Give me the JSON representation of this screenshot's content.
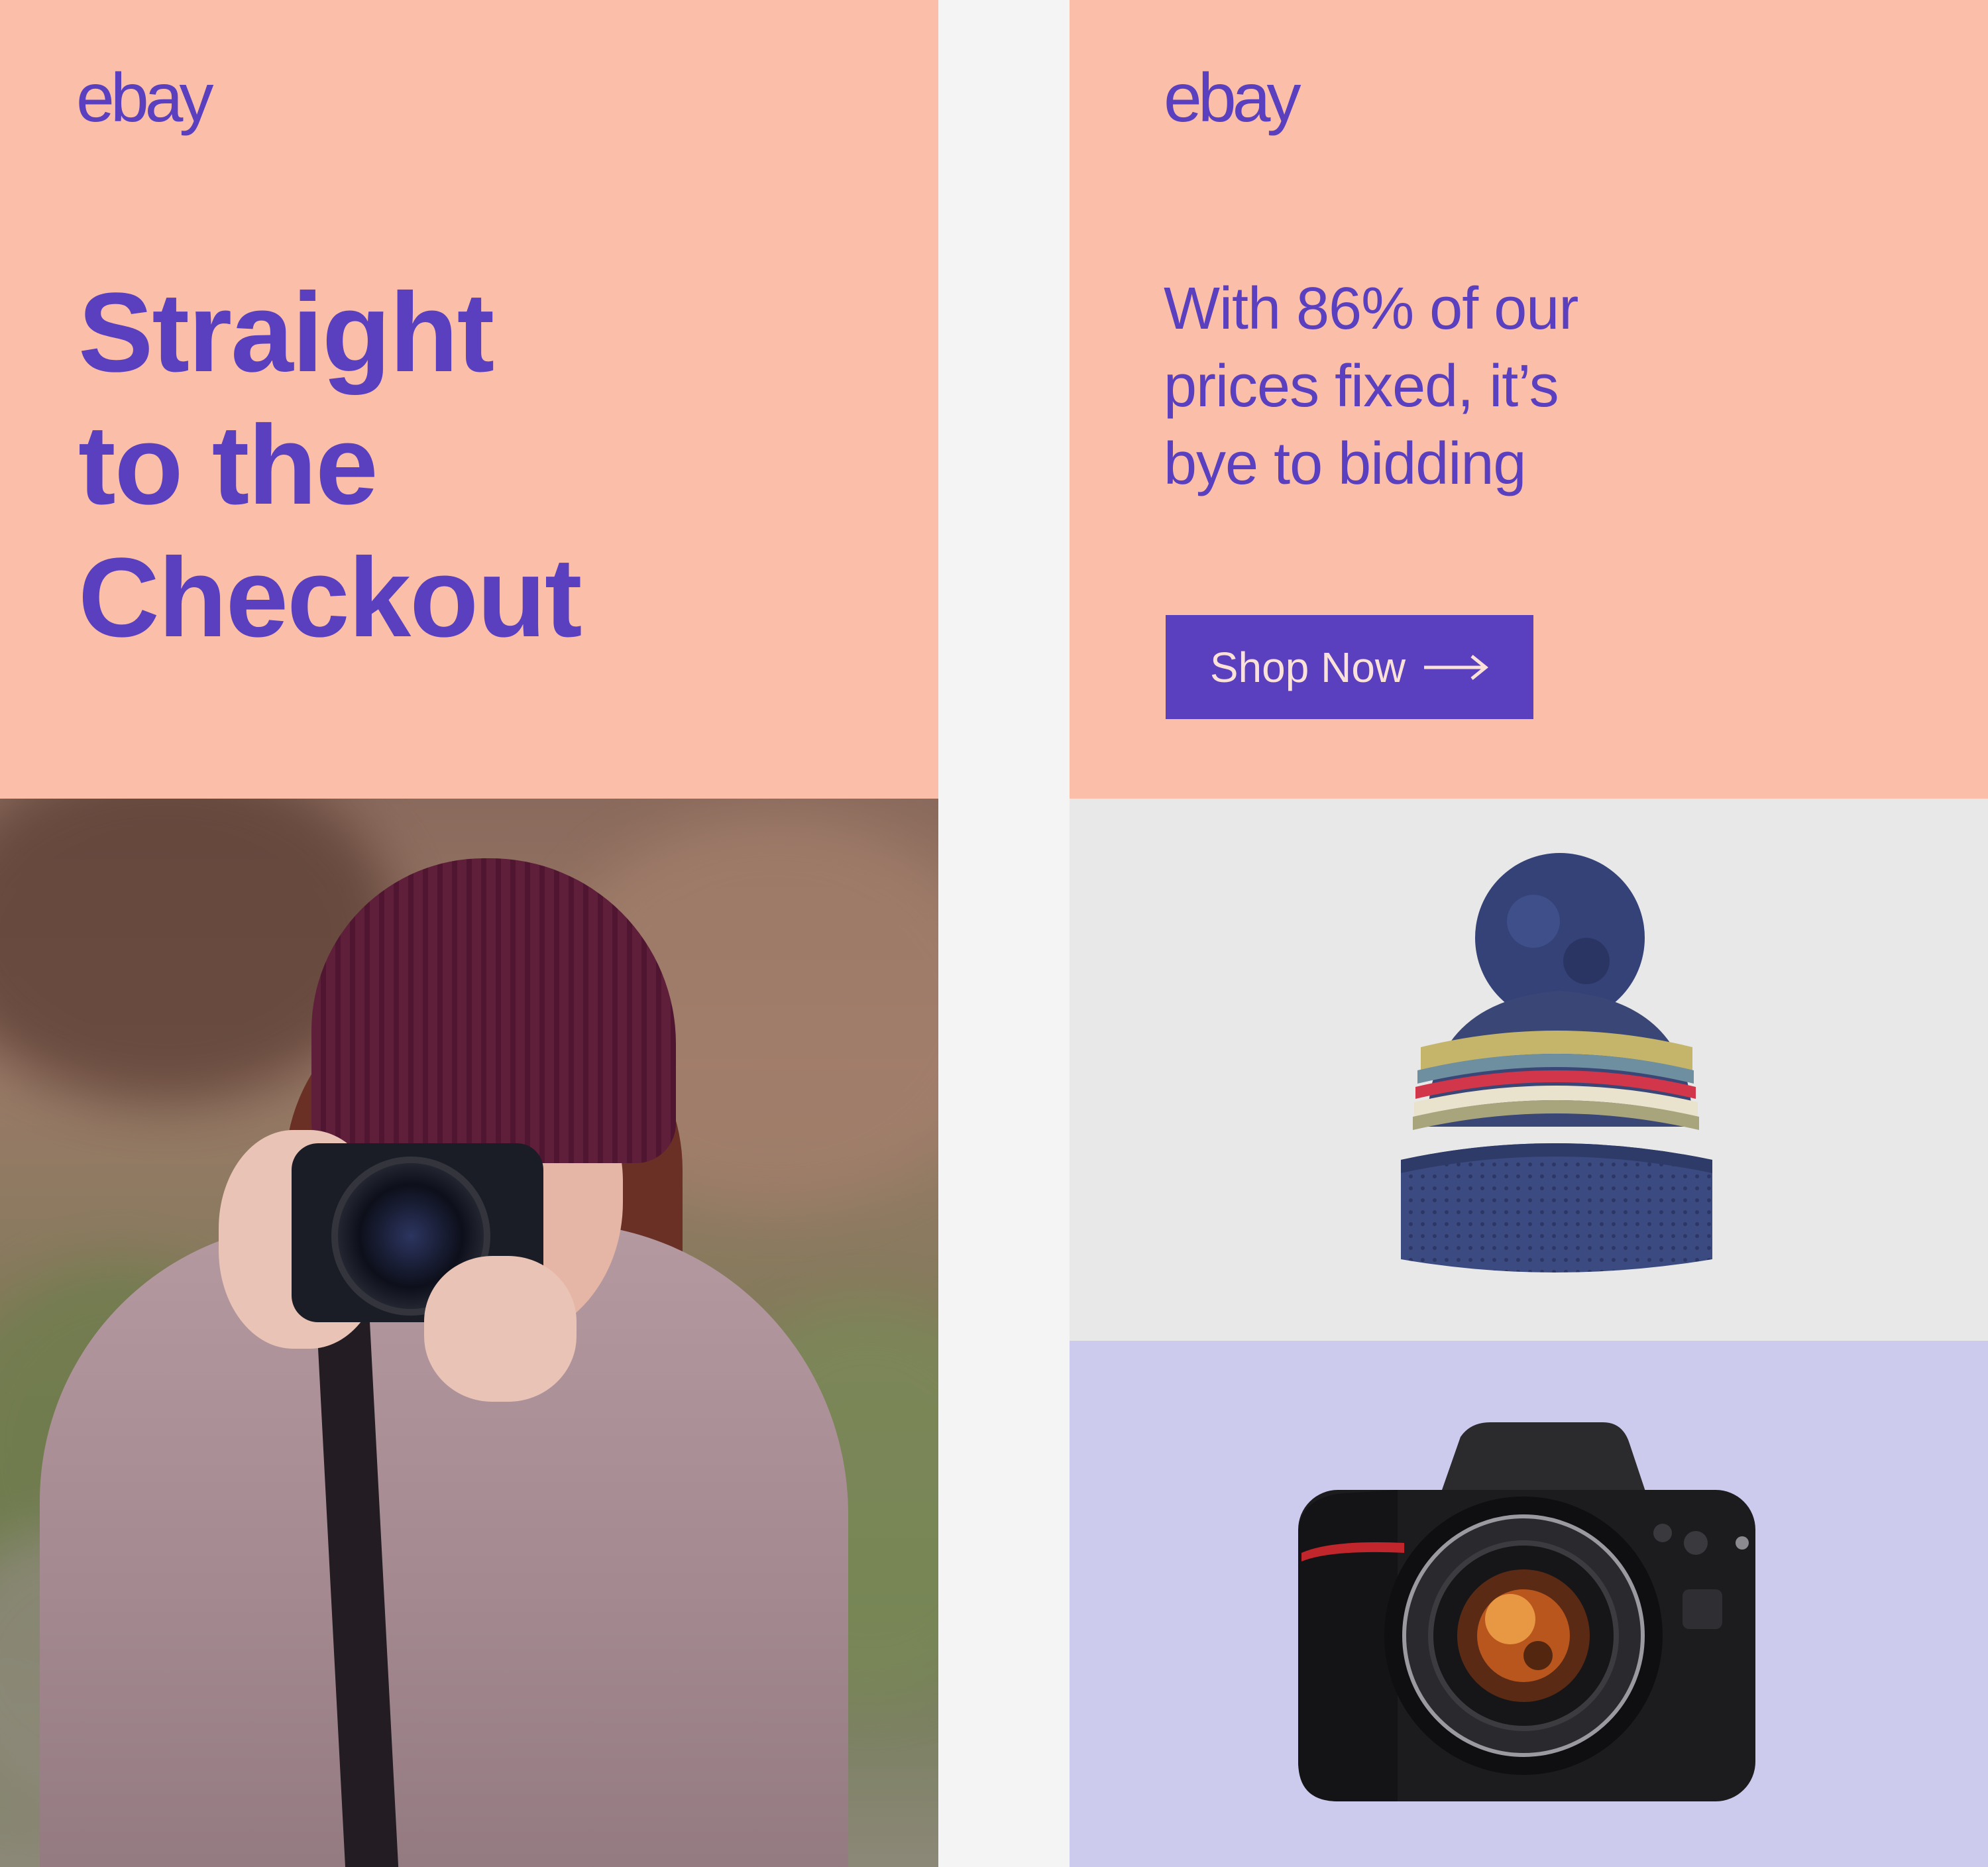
{
  "left_tile": {
    "logo": "ebay",
    "headline_lines": [
      "Straight",
      "to the",
      "Checkout"
    ],
    "photo_subject": "woman-with-camera"
  },
  "right_tile": {
    "logo": "ebay",
    "tagline_lines": [
      "With 86% of our",
      "prices fixed, it’s",
      "bye to bidding"
    ],
    "cta": {
      "label": "Shop Now",
      "icon": "arrow-right-icon"
    },
    "products": [
      {
        "icon": "beanie-hat-icon"
      },
      {
        "icon": "dslr-camera-icon"
      }
    ]
  },
  "colors": {
    "peach": "#fbbfa9",
    "purple": "#5a3fbf",
    "light_gray": "#e8e8e8",
    "lavender": "#cccbee",
    "gap": "#f4f4f4"
  }
}
